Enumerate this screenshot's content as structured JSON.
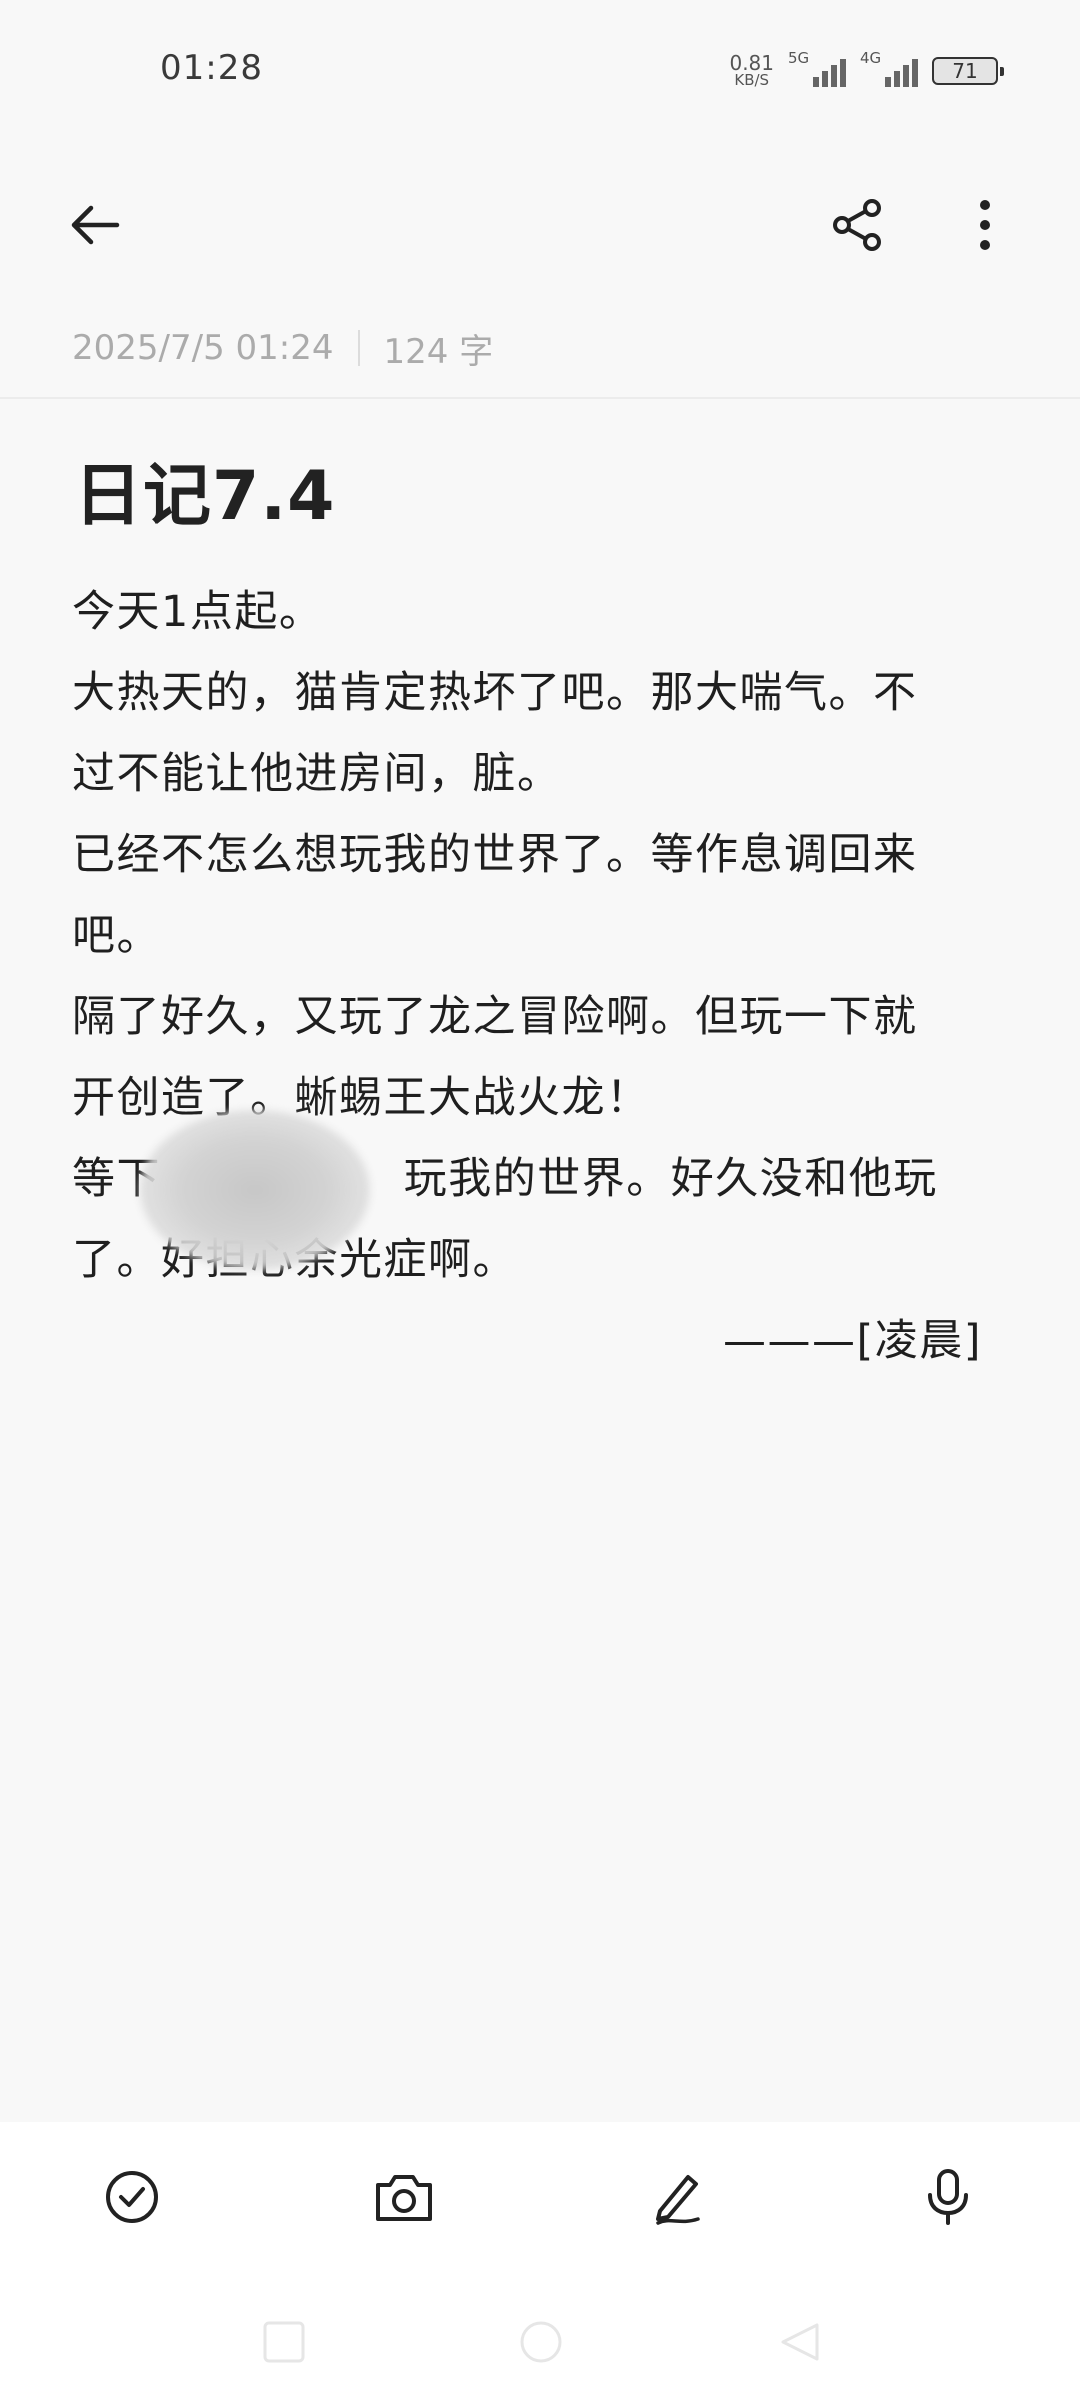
{
  "status_bar": {
    "time": "01:28",
    "net_speed_value": "0.81",
    "net_speed_unit": "KB/S",
    "signal_1_label": "5G",
    "signal_2_label": "4G",
    "battery_level": "71"
  },
  "meta": {
    "datetime": "2025/7/5 01:24",
    "word_count": "124 字"
  },
  "note": {
    "title": "日记7.4",
    "lines": [
      "今天1点起。",
      "大热天的，猫肯定热坏了吧。那大喘气。不",
      "过不能让他进房间，脏。",
      "已经不怎么想玩我的世界了。等作息调回来",
      "吧。",
      "隔了好久，又玩了龙之冒险啊。但玩一下就",
      "开创造了。蜥蜴王大战火龙！",
      "等下                玩我的世界。好久没和他玩",
      "了。好担心余光症啊。"
    ],
    "signature": "———[凌晨]"
  },
  "icons": {
    "back": "arrow-left-icon",
    "share": "share-icon",
    "more": "more-vertical-icon",
    "checklist": "check-circle-icon",
    "camera": "camera-icon",
    "handwrite": "pen-icon",
    "voice": "microphone-icon"
  }
}
